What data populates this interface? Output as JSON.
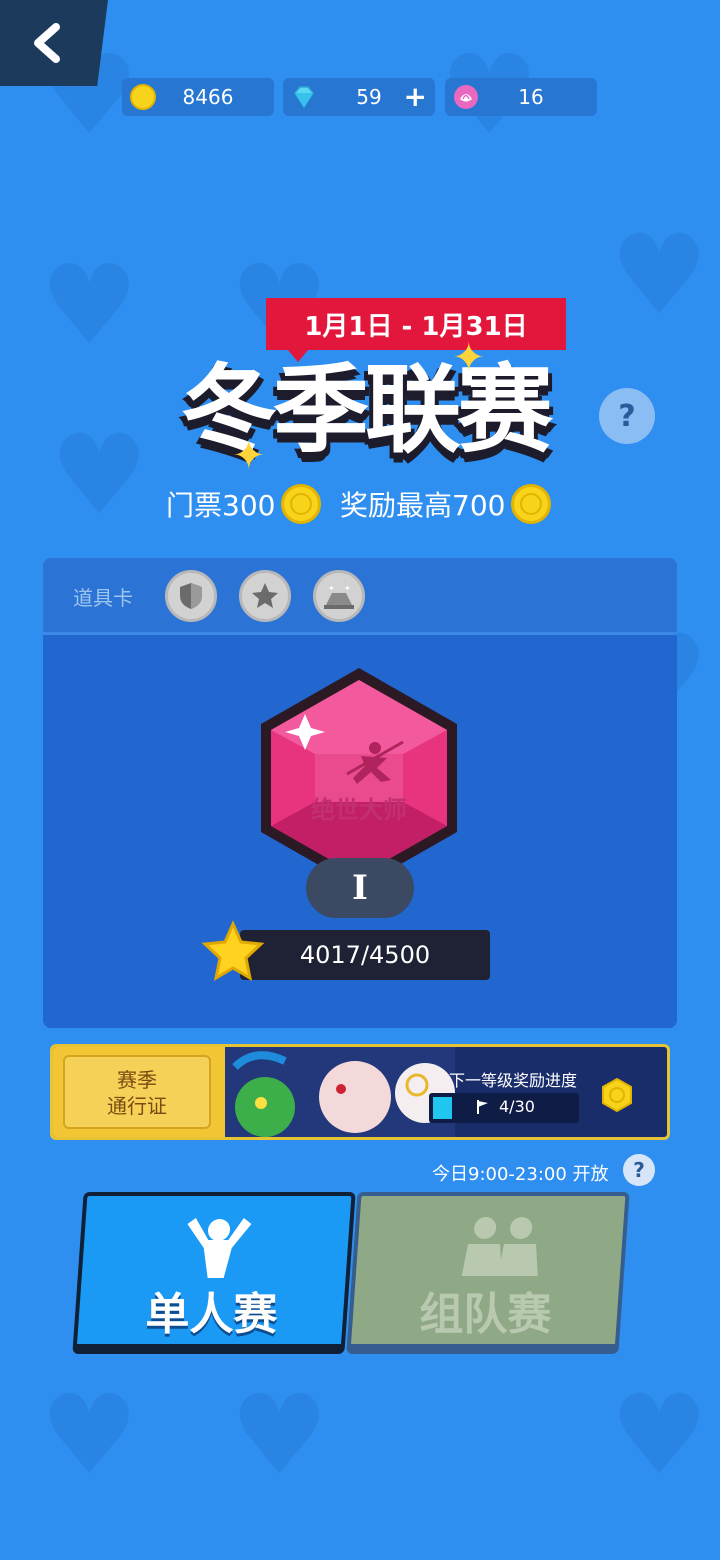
{
  "header": {
    "back_icon": "chevron-left-icon"
  },
  "currency": {
    "coins": {
      "icon": "gold-coin-icon",
      "value": "8466",
      "color": "#f7d31b"
    },
    "gems": {
      "icon": "diamond-icon",
      "value": "59",
      "add_label": "+",
      "color": "#5ad7f5"
    },
    "tickets": {
      "icon": "lotus-icon",
      "value": "16",
      "color": "#e968c0"
    }
  },
  "event": {
    "date_range": "1月1日 - 1月31日",
    "title": "冬季联赛",
    "help_label": "?",
    "ticket_label": "门票300",
    "reward_label": "奖励最高700"
  },
  "items": {
    "label": "道具卡",
    "cards": [
      "shield-icon",
      "star-icon",
      "bowl-icon"
    ]
  },
  "rank": {
    "name": "绝世大师",
    "tier": "I",
    "progress_text": "4017/4500",
    "progress_current": 4017,
    "progress_max": 4500,
    "gem_color": "#e8337f"
  },
  "season_pass": {
    "label_line1": "赛季",
    "label_line2": "通行证",
    "next_reward_label": "下一等级奖励进度",
    "count": "4/30",
    "progress_fraction": 0.133
  },
  "schedule": {
    "open_time": "今日9:00-23:00 开放",
    "help_label": "?"
  },
  "modes": {
    "single": {
      "label": "单人赛",
      "icon": "single-player-icon"
    },
    "team": {
      "label": "组队赛",
      "icon": "team-players-icon"
    }
  }
}
